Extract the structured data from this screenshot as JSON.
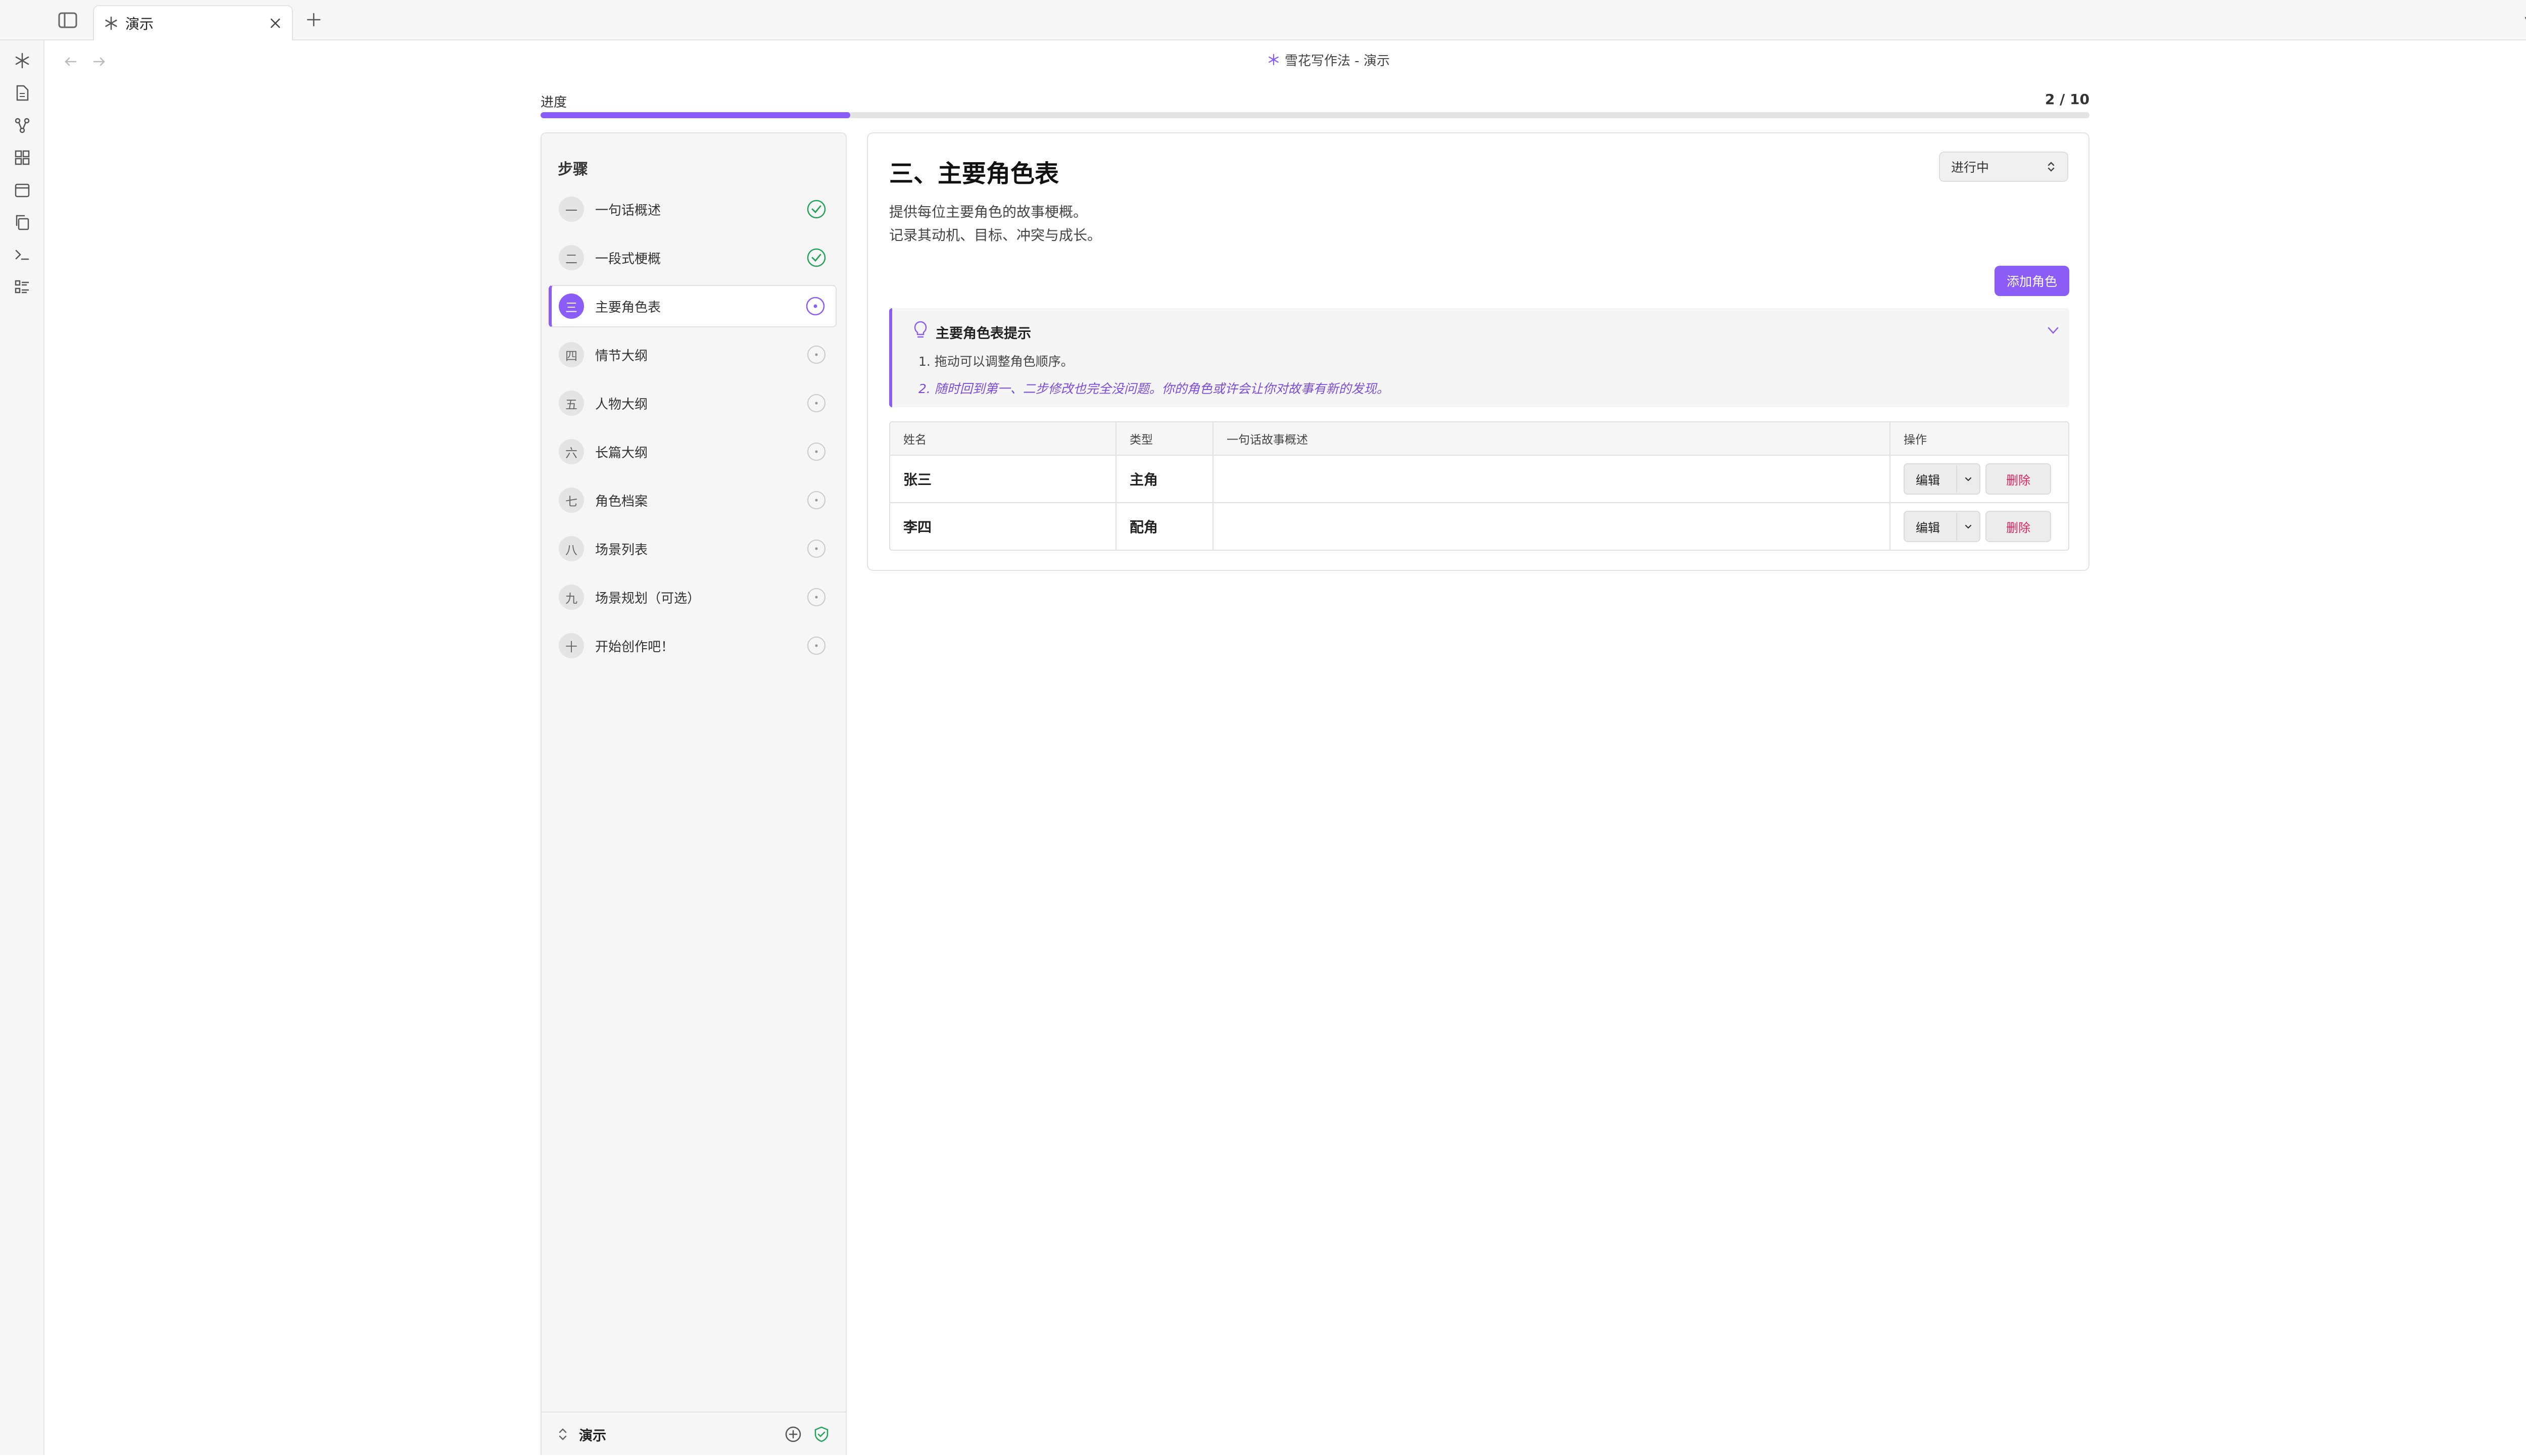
{
  "tab": {
    "title": "演示",
    "icon": "snowflake-icon"
  },
  "header": {
    "breadcrumb": "雪花写作法 - 演示"
  },
  "progress": {
    "label": "进度",
    "current": 2,
    "total": 10,
    "text": "2 / 10",
    "fraction": 0.2
  },
  "ribbon": {
    "icons": [
      "snowflake-icon",
      "file-icon",
      "graph-icon",
      "grid-icon",
      "calendar-icon",
      "copy-icon",
      "terminal-icon",
      "list-icon"
    ]
  },
  "steps": {
    "title": "步骤",
    "items": [
      {
        "num": "一",
        "label": "一句话概述",
        "status": "done"
      },
      {
        "num": "二",
        "label": "一段式梗概",
        "status": "done"
      },
      {
        "num": "三",
        "label": "主要角色表",
        "status": "active"
      },
      {
        "num": "四",
        "label": "情节大纲",
        "status": "pending"
      },
      {
        "num": "五",
        "label": "人物大纲",
        "status": "pending"
      },
      {
        "num": "六",
        "label": "长篇大纲",
        "status": "pending"
      },
      {
        "num": "七",
        "label": "角色档案",
        "status": "pending"
      },
      {
        "num": "八",
        "label": "场景列表",
        "status": "pending"
      },
      {
        "num": "九",
        "label": "场景规划（可选）",
        "status": "pending"
      },
      {
        "num": "十",
        "label": "开始创作吧！",
        "status": "pending"
      }
    ],
    "footer": {
      "project": "演示"
    }
  },
  "main": {
    "title": "三、主要角色表",
    "status_value": "进行中",
    "description": [
      "提供每位主要角色的故事梗概。",
      "记录其动机、目标、冲突与成长。"
    ],
    "add_button": "添加角色",
    "tip": {
      "title": "主要角色表提示",
      "items": [
        "1. 拖动可以调整角色顺序。",
        "2. 随时回到第一、二步修改也完全没问题。你的角色或许会让你对故事有新的发现。"
      ]
    },
    "table": {
      "headers": [
        "姓名",
        "类型",
        "一句话故事概述",
        "操作"
      ],
      "rows": [
        {
          "name": "张三",
          "type": "主角",
          "summary": ""
        },
        {
          "name": "李四",
          "type": "配角",
          "summary": ""
        }
      ],
      "edit_label": "编辑",
      "delete_label": "删除"
    }
  },
  "colors": {
    "accent": "#8b5cf6",
    "done": "#22a35a",
    "danger": "#e0245e"
  }
}
